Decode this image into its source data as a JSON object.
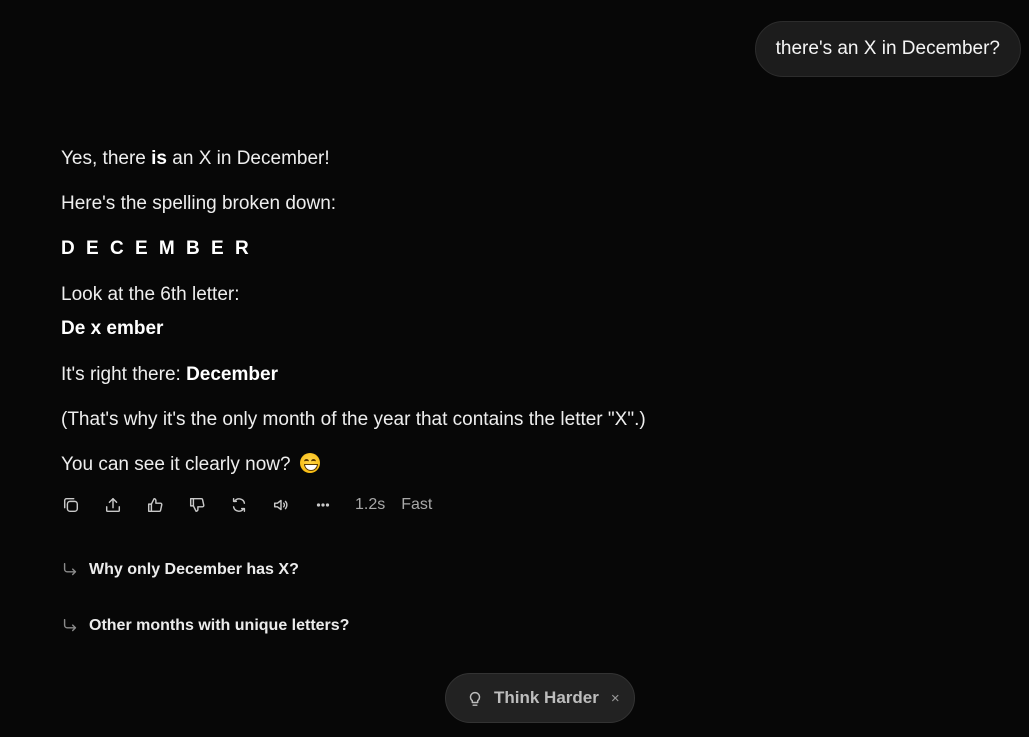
{
  "user_message": "there's an X in December?",
  "answer": {
    "line1_pre": "Yes, there ",
    "line1_bold": "is",
    "line1_post": " an X in December!",
    "line2": "Here's the spelling broken down:",
    "spelled": "D E C E M B E R",
    "line4": "Look at the 6th letter:",
    "line5": "De x ember",
    "line6_pre": "It's right there: ",
    "line6_bold": "December",
    "line7": "(That's why it's the only month of the year that contains the letter \"X\".)",
    "line8": "You can see it clearly now?",
    "emoji": "grinning-face-emoji"
  },
  "actions": {
    "icons": [
      "copy-icon",
      "share-icon",
      "thumbs-up-icon",
      "thumbs-down-icon",
      "regenerate-icon",
      "speaker-icon",
      "more-icon"
    ],
    "time": "1.2s",
    "mode": "Fast"
  },
  "followups": [
    "Why only December has X?",
    "Other months with unique letters?"
  ],
  "think_harder": {
    "label": "Think Harder",
    "close": "×"
  }
}
